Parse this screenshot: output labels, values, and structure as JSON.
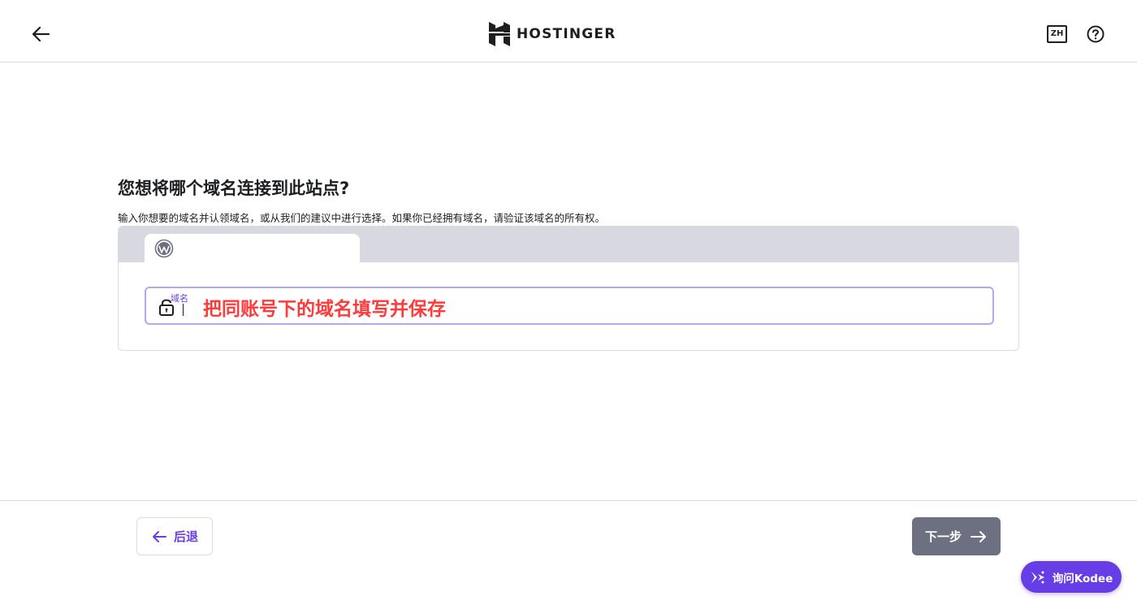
{
  "header": {
    "brand": "HOSTINGER",
    "language": "ZH"
  },
  "main": {
    "title": "您想将哪个域名连接到此站点?",
    "subtitle": "输入你想要的域名并认领域名，或从我们的建议中进行选择。如果你已经拥有域名，请验证该域名的所有权。",
    "domain_field": {
      "label": "域名",
      "value": "",
      "annotation": "把同账号下的域名填写并保存"
    }
  },
  "footer": {
    "back_label": "后退",
    "next_label": "下一步"
  },
  "assistant": {
    "label": "询问Kodee"
  },
  "colors": {
    "accent": "#673de6",
    "next_button": "#6d7081",
    "annotation": "#fc3b3b",
    "input_border": "#b3a9ee"
  }
}
